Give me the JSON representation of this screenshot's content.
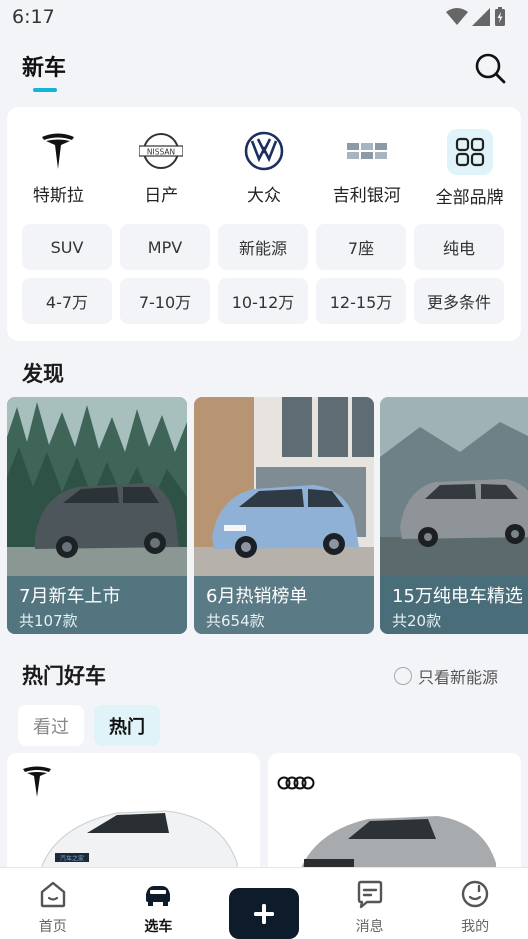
{
  "status": {
    "time": "6:17"
  },
  "header": {
    "title": "新车"
  },
  "brands": [
    {
      "label": "特斯拉",
      "icon": "tesla-logo"
    },
    {
      "label": "日产",
      "icon": "nissan-logo"
    },
    {
      "label": "大众",
      "icon": "volkswagen-logo"
    },
    {
      "label": "吉利银河",
      "icon": "geely-galaxy-logo"
    },
    {
      "label": "全部品牌",
      "icon": "all-brands-icon"
    }
  ],
  "tags": [
    "SUV",
    "MPV",
    "新能源",
    "7座",
    "纯电",
    "4-7万",
    "7-10万",
    "10-12万",
    "12-15万",
    "更多条件"
  ],
  "discover": {
    "title": "发现",
    "items": [
      {
        "name": "7月新车上市",
        "count": "共107款"
      },
      {
        "name": "6月热销榜单",
        "count": "共654款"
      },
      {
        "name": "15万纯电车精选",
        "count": "共20款"
      }
    ]
  },
  "hot": {
    "title": "热门好车",
    "ev_only": "只看新能源",
    "tabs": [
      "看过",
      "热门"
    ]
  },
  "car_brand_text": {
    "tesla": "T",
    "plate": "汽车之家"
  },
  "tabbar": [
    "首页",
    "选车",
    "消息",
    "我的"
  ],
  "colors": {
    "accent": "#14b4d8",
    "dark": "#0d1b2a"
  }
}
